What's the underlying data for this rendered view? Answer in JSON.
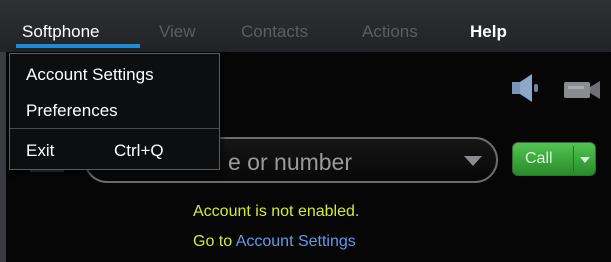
{
  "menubar": {
    "items": [
      {
        "label": "Softphone",
        "state": "active"
      },
      {
        "label": "View",
        "state": "disabled"
      },
      {
        "label": "Contacts",
        "state": "disabled"
      },
      {
        "label": "Actions",
        "state": "disabled"
      },
      {
        "label": "Help",
        "state": "enabled"
      }
    ]
  },
  "dropdown": {
    "items": [
      {
        "label": "Account Settings",
        "shortcut": ""
      },
      {
        "label": "Preferences",
        "shortcut": ""
      },
      {
        "label": "Exit",
        "shortcut": "Ctrl+Q"
      }
    ]
  },
  "dial": {
    "visible_placeholder": "e or number"
  },
  "call_button": {
    "label": "Call"
  },
  "status": {
    "message": "Account is not enabled.",
    "goto_prefix": "Go to",
    "goto_link": "Account Settings"
  },
  "icons": {
    "speaker": "speaker-icon",
    "camera": "camera-icon",
    "dropdown_arrow": "chevron-down-icon"
  },
  "colors": {
    "accent": "#1f8dd6",
    "status_text": "#d8ea30",
    "link": "#5f9cf0",
    "call_green": "#3fae3f"
  }
}
